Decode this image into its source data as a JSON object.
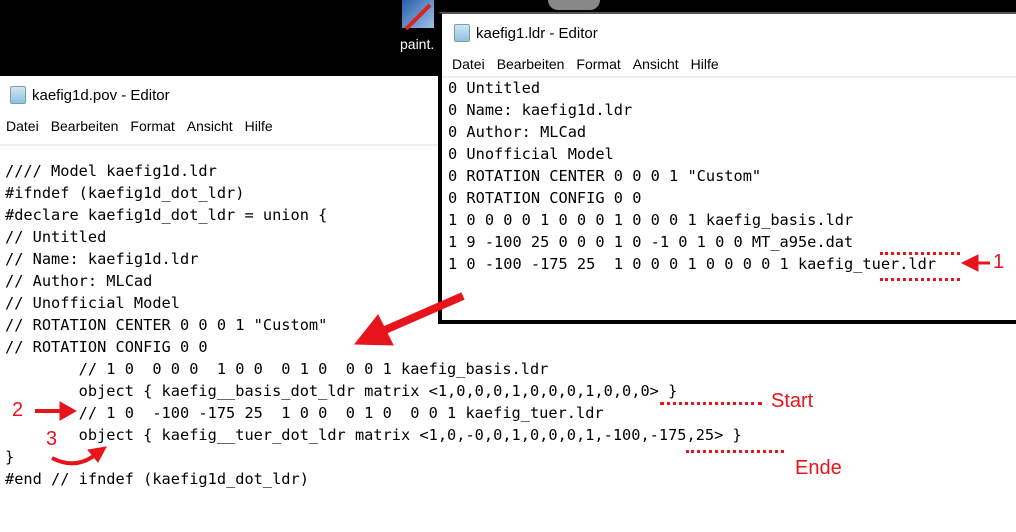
{
  "desktop": {
    "shortcut_label": "paint."
  },
  "left_window": {
    "title": "kaefig1d.pov - Editor",
    "menu": [
      "Datei",
      "Bearbeiten",
      "Format",
      "Ansicht",
      "Hilfe"
    ],
    "lines": [
      "//// Model kaefig1d.ldr",
      "#ifndef (kaefig1d_dot_ldr)",
      "#declare kaefig1d_dot_ldr = union {",
      "// Untitled",
      "// Name: kaefig1d.ldr",
      "// Author: MLCad",
      "// Unofficial Model",
      "// ROTATION CENTER 0 0 0 1 \"Custom\"",
      "// ROTATION CONFIG 0 0",
      "        // 1 0  0 0 0  1 0 0  0 1 0  0 0 1 kaefig_basis.ldr",
      "        object { kaefig__basis_dot_ldr matrix <1,0,0,0,1,0,0,0,1,0,0,0> }",
      "        // 1 0  -100 -175 25  1 0 0  0 1 0  0 0 1 kaefig_tuer.ldr",
      "        object { kaefig__tuer_dot_ldr matrix <1,0,-0,0,1,0,0,0,1,-100,-175,25> }",
      "}",
      "#end // ifndef (kaefig1d_dot_ldr)"
    ]
  },
  "right_window": {
    "title": "kaefig1.ldr - Editor",
    "menu": [
      "Datei",
      "Bearbeiten",
      "Format",
      "Ansicht",
      "Hilfe"
    ],
    "lines": [
      "0 Untitled",
      "0 Name: kaefig1d.ldr",
      "0 Author: MLCad",
      "0 Unofficial Model",
      "0 ROTATION CENTER 0 0 0 1 \"Custom\"",
      "0 ROTATION CONFIG 0 0",
      "1 0 0 0 0 1 0 0 0 1 0 0 0 1 kaefig_basis.ldr",
      "1 9 -100 25 0 0 0 1 0 -1 0 1 0 0 MT_a95e.dat",
      "1 0 -100 -175 25  1 0 0 0 1 0 0 0 0 1 kaefig_tuer.ldr"
    ]
  },
  "annotations": {
    "marker1": "1",
    "marker2": "2",
    "marker3": "3",
    "start": "Start",
    "end": "Ende",
    "color": "#e8141c"
  }
}
